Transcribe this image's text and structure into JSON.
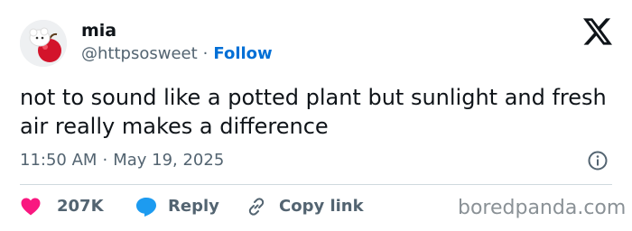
{
  "author": {
    "display_name": "mia",
    "handle": "@httpsosweet",
    "separator": "·",
    "follow_label": "Follow"
  },
  "tweet": {
    "text": "not to sound like a potted plant but sunlight and fresh air really makes a difference",
    "time": "11:50 AM",
    "separator": "·",
    "date": "May 19, 2025"
  },
  "actions": {
    "like_count": "207K",
    "reply_label": "Reply",
    "copy_link_label": "Copy link"
  },
  "watermark": "boredpanda.com",
  "colors": {
    "like": "#f91880",
    "reply": "#1d9bf0",
    "follow": "#006fd6",
    "muted": "#536471",
    "text": "#0f1419"
  },
  "icons": [
    "x-logo-icon",
    "info-icon",
    "heart-icon",
    "reply-bubble-icon",
    "link-icon"
  ]
}
